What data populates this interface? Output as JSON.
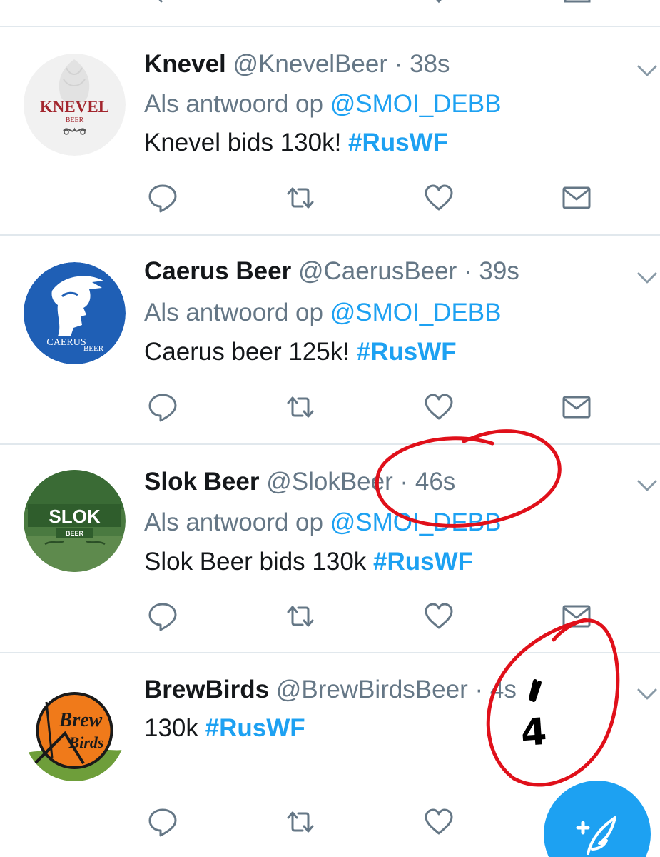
{
  "tweets": [
    {
      "display_name": "Knevel",
      "handle": "@KnevelBeer",
      "dot": "·",
      "time": "38s",
      "reply_prefix": "Als antwoord op",
      "reply_to": "@SMOI_DEBB",
      "text": "Knevel bids 130k!",
      "hashtag": "#RusWF",
      "avatar": {
        "label": "KNEVEL",
        "sublabel": "BEER",
        "bg": "#f1f1f1",
        "accent": "#a3262e"
      }
    },
    {
      "display_name": "Caerus Beer",
      "handle": "@CaerusBeer",
      "dot": "·",
      "time": "39s",
      "reply_prefix": "Als antwoord op",
      "reply_to": "@SMOI_DEBB",
      "text": "Caerus beer 125k!",
      "hashtag": "#RusWF",
      "avatar": {
        "label": "CAERUS",
        "sublabel": "BEER",
        "bg": "#1f5fb5",
        "accent": "#ffffff"
      }
    },
    {
      "display_name": "Slok Beer",
      "handle": "@SlokBeer",
      "dot": "·",
      "time": "46s",
      "reply_prefix": "Als antwoord op",
      "reply_to": "@SMOI_DEBB",
      "text": "Slok Beer bids 130k",
      "hashtag": "#RusWF",
      "avatar": {
        "label": "SLOK",
        "sublabel": "BEER",
        "bg": "#3a6b35",
        "accent": "#ffffff"
      }
    },
    {
      "display_name": "BrewBirds",
      "handle": "@BrewBirdsBeer",
      "dot": "·",
      "time": "4s",
      "text": "130k",
      "hashtag": "#RusWF",
      "avatar": {
        "label": "Brew",
        "sublabel": "Birds",
        "bg": "#ffffff",
        "accent": "#f07a1a"
      }
    }
  ],
  "annotation": {
    "handwritten_digit": "4"
  },
  "icons": {
    "reply": "reply-icon",
    "retweet": "retweet-icon",
    "like": "heart-icon",
    "dm": "envelope-icon",
    "caret": "chevron-down-icon",
    "compose": "compose-tweet-icon"
  },
  "colors": {
    "link": "#1da1f2",
    "secondary_text": "#657786",
    "icon": "#657786",
    "divider": "#e1e8ed",
    "annotation": "#e0101a"
  }
}
